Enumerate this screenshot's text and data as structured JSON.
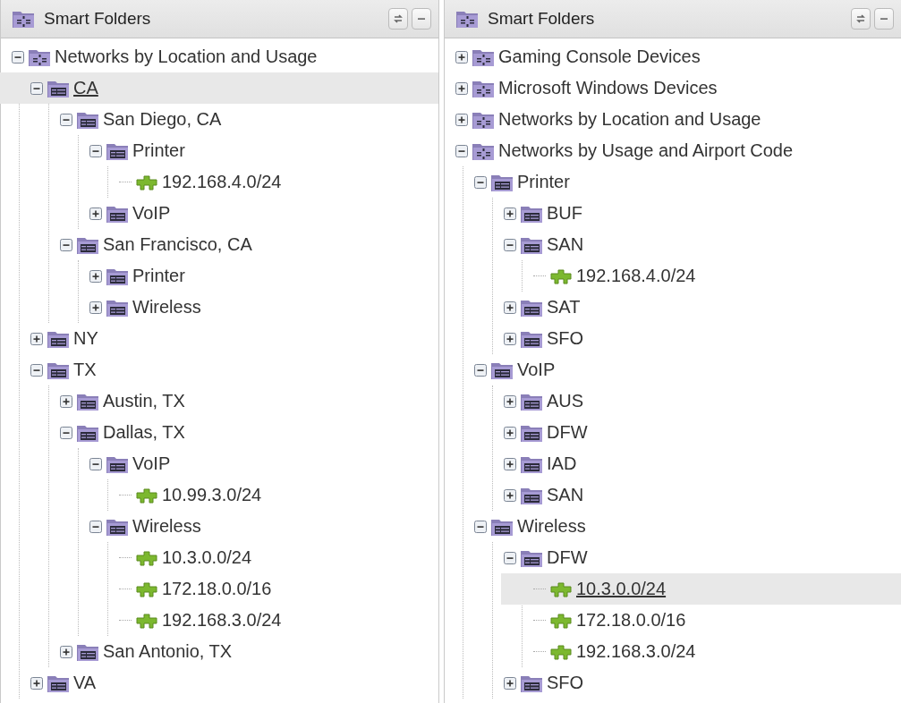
{
  "panels": [
    {
      "title": "Smart Folders",
      "tree": [
        {
          "kind": "smart",
          "label": "Networks by Location and Usage",
          "expanded": true,
          "selected": false,
          "children": [
            {
              "kind": "folder",
              "label": "CA",
              "expanded": true,
              "selected": true,
              "children": [
                {
                  "kind": "folder",
                  "label": "San Diego, CA",
                  "expanded": true,
                  "selected": false,
                  "children": [
                    {
                      "kind": "folder",
                      "label": "Printer",
                      "expanded": true,
                      "selected": false,
                      "children": [
                        {
                          "kind": "network",
                          "label": "192.168.4.0/24",
                          "selected": false
                        }
                      ]
                    },
                    {
                      "kind": "folder",
                      "label": "VoIP",
                      "expanded": false,
                      "selected": false
                    }
                  ]
                },
                {
                  "kind": "folder",
                  "label": "San Francisco, CA",
                  "expanded": true,
                  "selected": false,
                  "children": [
                    {
                      "kind": "folder",
                      "label": "Printer",
                      "expanded": false,
                      "selected": false
                    },
                    {
                      "kind": "folder",
                      "label": "Wireless",
                      "expanded": false,
                      "selected": false
                    }
                  ]
                }
              ]
            },
            {
              "kind": "folder",
              "label": "NY",
              "expanded": false,
              "selected": false
            },
            {
              "kind": "folder",
              "label": "TX",
              "expanded": true,
              "selected": false,
              "children": [
                {
                  "kind": "folder",
                  "label": "Austin, TX",
                  "expanded": false,
                  "selected": false
                },
                {
                  "kind": "folder",
                  "label": "Dallas, TX",
                  "expanded": true,
                  "selected": false,
                  "children": [
                    {
                      "kind": "folder",
                      "label": "VoIP",
                      "expanded": true,
                      "selected": false,
                      "children": [
                        {
                          "kind": "network",
                          "label": "10.99.3.0/24",
                          "selected": false
                        }
                      ]
                    },
                    {
                      "kind": "folder",
                      "label": "Wireless",
                      "expanded": true,
                      "selected": false,
                      "children": [
                        {
                          "kind": "network",
                          "label": "10.3.0.0/24",
                          "selected": false
                        },
                        {
                          "kind": "network",
                          "label": "172.18.0.0/16",
                          "selected": false
                        },
                        {
                          "kind": "network",
                          "label": "192.168.3.0/24",
                          "selected": false
                        }
                      ]
                    }
                  ]
                },
                {
                  "kind": "folder",
                  "label": "San Antonio, TX",
                  "expanded": false,
                  "selected": false
                }
              ]
            },
            {
              "kind": "folder",
              "label": "VA",
              "expanded": false,
              "selected": false
            }
          ]
        }
      ]
    },
    {
      "title": "Smart Folders",
      "tree": [
        {
          "kind": "smart",
          "label": "Gaming Console Devices",
          "expanded": false,
          "selected": false
        },
        {
          "kind": "smart",
          "label": "Microsoft Windows Devices",
          "expanded": false,
          "selected": false
        },
        {
          "kind": "smart",
          "label": "Networks by Location and Usage",
          "expanded": false,
          "selected": false
        },
        {
          "kind": "smart",
          "label": "Networks by Usage and Airport Code",
          "expanded": true,
          "selected": false,
          "children": [
            {
              "kind": "folder",
              "label": "Printer",
              "expanded": true,
              "selected": false,
              "children": [
                {
                  "kind": "folder",
                  "label": "BUF",
                  "expanded": false,
                  "selected": false
                },
                {
                  "kind": "folder",
                  "label": "SAN",
                  "expanded": true,
                  "selected": false,
                  "children": [
                    {
                      "kind": "network",
                      "label": "192.168.4.0/24",
                      "selected": false
                    }
                  ]
                },
                {
                  "kind": "folder",
                  "label": "SAT",
                  "expanded": false,
                  "selected": false
                },
                {
                  "kind": "folder",
                  "label": "SFO",
                  "expanded": false,
                  "selected": false
                }
              ]
            },
            {
              "kind": "folder",
              "label": "VoIP",
              "expanded": true,
              "selected": false,
              "children": [
                {
                  "kind": "folder",
                  "label": "AUS",
                  "expanded": false,
                  "selected": false
                },
                {
                  "kind": "folder",
                  "label": "DFW",
                  "expanded": false,
                  "selected": false
                },
                {
                  "kind": "folder",
                  "label": "IAD",
                  "expanded": false,
                  "selected": false
                },
                {
                  "kind": "folder",
                  "label": "SAN",
                  "expanded": false,
                  "selected": false
                }
              ]
            },
            {
              "kind": "folder",
              "label": "Wireless",
              "expanded": true,
              "selected": false,
              "children": [
                {
                  "kind": "folder",
                  "label": "DFW",
                  "expanded": true,
                  "selected": false,
                  "children": [
                    {
                      "kind": "network",
                      "label": "10.3.0.0/24",
                      "selected": true
                    },
                    {
                      "kind": "network",
                      "label": "172.18.0.0/16",
                      "selected": false
                    },
                    {
                      "kind": "network",
                      "label": "192.168.3.0/24",
                      "selected": false
                    }
                  ]
                },
                {
                  "kind": "folder",
                  "label": "SFO",
                  "expanded": false,
                  "selected": false
                }
              ]
            }
          ]
        }
      ]
    }
  ]
}
